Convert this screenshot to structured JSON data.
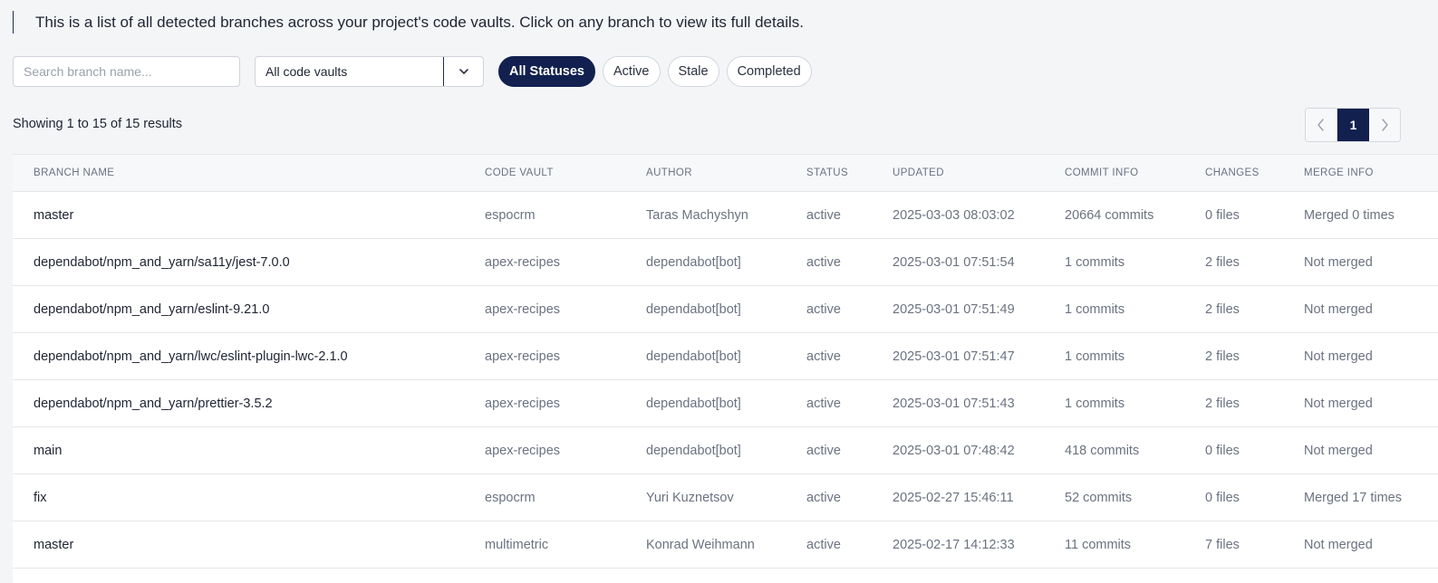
{
  "intro_text": "This is a list of all detected branches across your project's code vaults. Click on any branch to view its full details.",
  "search": {
    "placeholder": "Search branch name..."
  },
  "vault_filter": {
    "selected": "All code vaults"
  },
  "status_filters": [
    "All Statuses",
    "Active",
    "Stale",
    "Completed"
  ],
  "status_filter_selected": "All Statuses",
  "results_text": "Showing 1 to 15 of 15 results",
  "pagination": {
    "current_page": "1"
  },
  "table": {
    "columns": [
      "BRANCH NAME",
      "CODE VAULT",
      "AUTHOR",
      "STATUS",
      "UPDATED",
      "COMMIT INFO",
      "CHANGES",
      "MERGE INFO"
    ],
    "rows": [
      [
        "master",
        "espocrm",
        "Taras Machyshyn",
        "active",
        "2025-03-03 08:03:02",
        "20664 commits",
        "0 files",
        "Merged 0 times"
      ],
      [
        "dependabot/npm_and_yarn/sa11y/jest-7.0.0",
        "apex-recipes",
        "dependabot[bot]",
        "active",
        "2025-03-01 07:51:54",
        "1 commits",
        "2 files",
        "Not merged"
      ],
      [
        "dependabot/npm_and_yarn/eslint-9.21.0",
        "apex-recipes",
        "dependabot[bot]",
        "active",
        "2025-03-01 07:51:49",
        "1 commits",
        "2 files",
        "Not merged"
      ],
      [
        "dependabot/npm_and_yarn/lwc/eslint-plugin-lwc-2.1.0",
        "apex-recipes",
        "dependabot[bot]",
        "active",
        "2025-03-01 07:51:47",
        "1 commits",
        "2 files",
        "Not merged"
      ],
      [
        "dependabot/npm_and_yarn/prettier-3.5.2",
        "apex-recipes",
        "dependabot[bot]",
        "active",
        "2025-03-01 07:51:43",
        "1 commits",
        "2 files",
        "Not merged"
      ],
      [
        "main",
        "apex-recipes",
        "dependabot[bot]",
        "active",
        "2025-03-01 07:48:42",
        "418 commits",
        "0 files",
        "Not merged"
      ],
      [
        "fix",
        "espocrm",
        "Yuri Kuznetsov",
        "active",
        "2025-02-27 15:46:11",
        "52 commits",
        "0 files",
        "Merged 17 times"
      ],
      [
        "master",
        "multimetric",
        "Konrad Weihmann",
        "active",
        "2025-02-17 14:12:33",
        "11 commits",
        "7 files",
        "Not merged"
      ]
    ]
  }
}
